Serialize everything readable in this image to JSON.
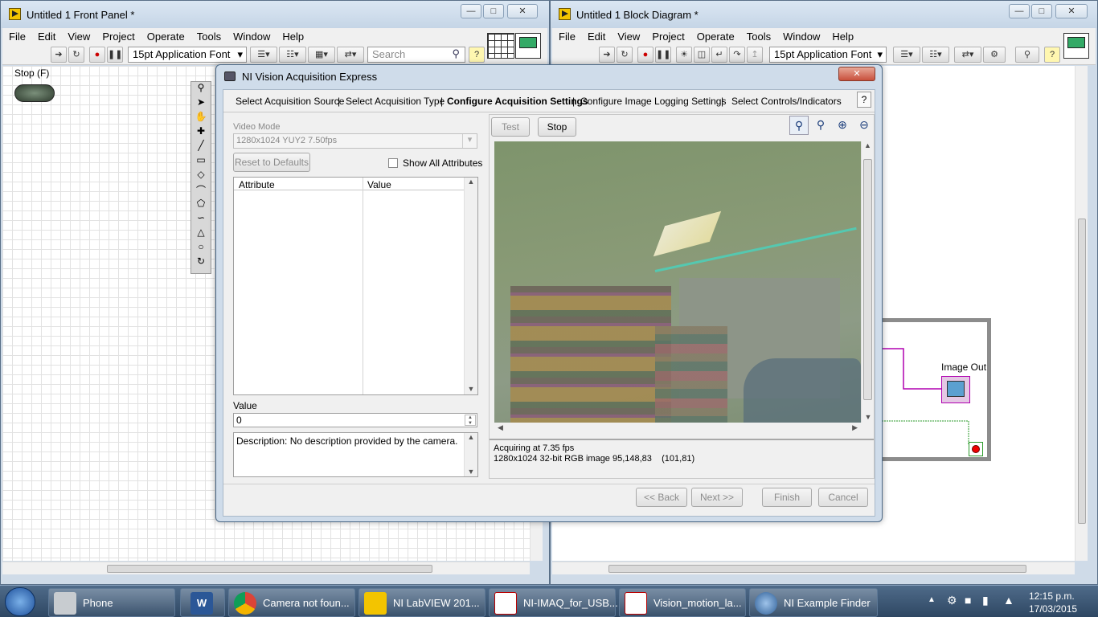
{
  "front_panel": {
    "title": "Untitled 1 Front Panel *",
    "menu": [
      "File",
      "Edit",
      "View",
      "Project",
      "Operate",
      "Tools",
      "Window",
      "Help"
    ],
    "font_label": "15pt Application Font",
    "search_placeholder": "Search",
    "stop_label": "Stop (F)"
  },
  "block_diagram": {
    "title": "Untitled 1 Block Diagram *",
    "menu": [
      "File",
      "Edit",
      "View",
      "Project",
      "Operate",
      "Tools",
      "Window",
      "Help"
    ],
    "font_label": "15pt Application Font",
    "image_out_label": "Image Out"
  },
  "dialog": {
    "title": "NI Vision Acquisition Express",
    "tabs": [
      "Select Acquisition Source",
      "Select Acquisition Type",
      "Configure Acquisition Settings",
      "Configure Image Logging Settings",
      "Select Controls/Indicators"
    ],
    "help_label": "?",
    "video_mode_label": "Video Mode",
    "video_mode_value": "1280x1024 YUY2 7.50fps",
    "reset_label": "Reset to Defaults",
    "show_all_label": "Show All Attributes",
    "col_attribute": "Attribute",
    "col_value": "Value",
    "value_label": "Value",
    "value_input": "0",
    "description": "Description: No description provided by the camera.",
    "test_label": "Test",
    "stop_label": "Stop",
    "status_line1": "Acquiring at 7.35 fps",
    "status_line2": "1280x1024 32-bit RGB image 95,148,83    (101,81)",
    "back_label": "<< Back",
    "next_label": "Next >>",
    "finish_label": "Finish",
    "cancel_label": "Cancel"
  },
  "taskbar": {
    "items": [
      "Phone",
      "",
      "Camera not foun...",
      "NI LabVIEW 201...",
      "NI-IMAQ_for_USB...",
      "Vision_motion_la...",
      "NI Example Finder"
    ],
    "time": "12:15 p.m.",
    "date": "17/03/2015"
  }
}
